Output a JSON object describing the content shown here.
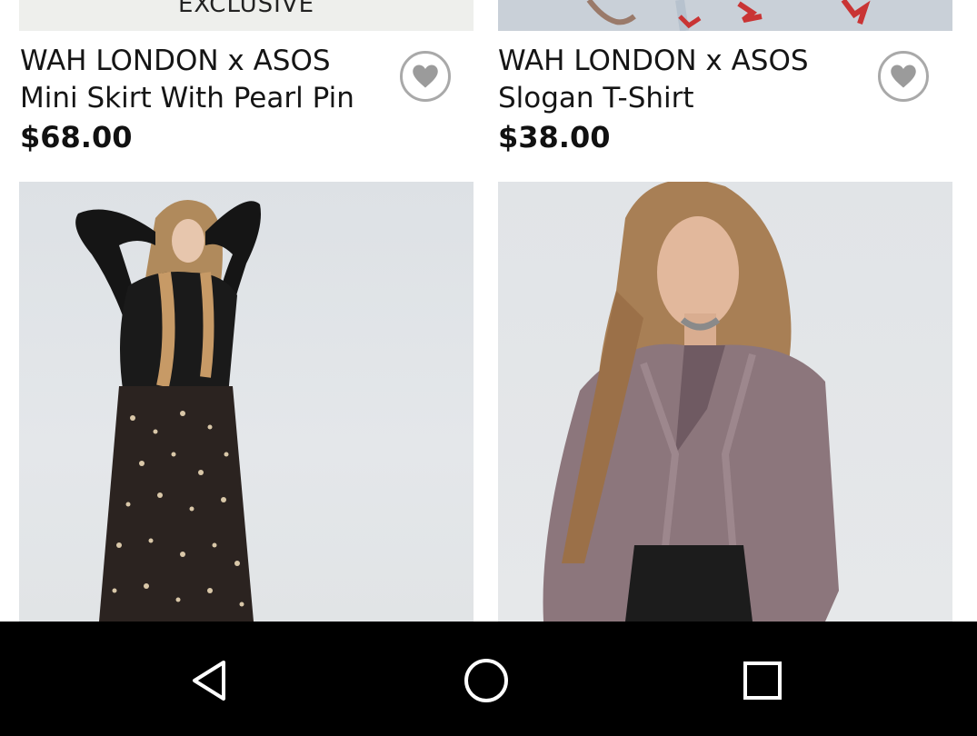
{
  "products": [
    {
      "brand": "WAH LONDON x ASOS",
      "name": "Mini Skirt With Pearl Pin",
      "price": "$68.00",
      "image_label": "EXCLUSIVE",
      "favorite_icon": "heart-icon"
    },
    {
      "brand": "WAH LONDON x ASOS",
      "name": "Slogan T-Shirt",
      "price": "$38.00",
      "favorite_icon": "heart-icon"
    }
  ],
  "nav_bar": {
    "back_icon": "back-triangle-icon",
    "home_icon": "home-circle-icon",
    "recents_icon": "recents-square-icon"
  },
  "colors": {
    "nav_background": "#000000",
    "heart_outline": "#a9a9a9",
    "heart_fill": "#9b9b9b"
  }
}
